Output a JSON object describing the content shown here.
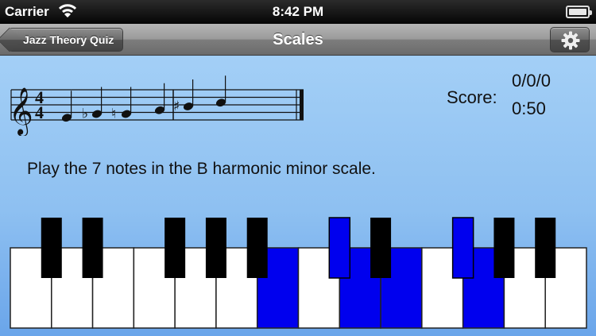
{
  "status_bar": {
    "carrier": "Carrier",
    "time": "8:42 PM"
  },
  "nav": {
    "back_label": "Jazz Theory Quiz",
    "title": "Scales"
  },
  "staff": {
    "clef": "treble-clef-icon",
    "time_signature": [
      "4",
      "4"
    ],
    "notes": [
      {
        "step": 1,
        "accidental": ""
      },
      {
        "step": 2,
        "accidental": "flat"
      },
      {
        "step": 2,
        "accidental": "natural"
      },
      {
        "step": 3,
        "accidental": ""
      },
      {
        "step": 4,
        "accidental": "sharp"
      },
      {
        "step": 5,
        "accidental": ""
      }
    ]
  },
  "score": {
    "label": "Score:",
    "value": "0/0/0",
    "timer": "0:50"
  },
  "prompt": "Play the 7 notes in the B harmonic minor scale.",
  "keyboard": {
    "white_keys": 14,
    "black_keys_after_white": [
      0,
      1,
      3,
      4,
      5,
      7,
      8,
      10,
      11,
      12
    ],
    "highlighted_white": [
      6,
      8,
      9,
      11
    ],
    "highlighted_black": [
      7,
      10
    ],
    "highlight_color": "#0000ee"
  }
}
